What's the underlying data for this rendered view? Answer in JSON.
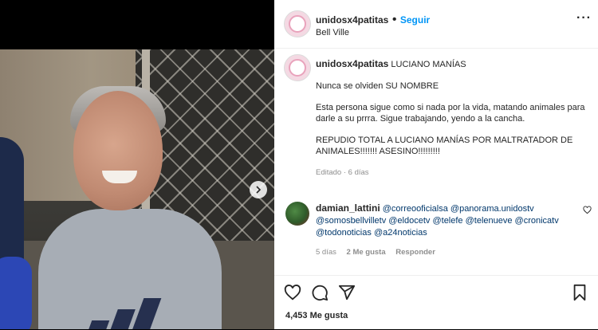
{
  "post": {
    "username": "unidosx4patitas",
    "separator": "•",
    "follow_label": "Seguir",
    "location": "Bell Ville",
    "more_label": "···"
  },
  "caption": {
    "username": "unidosx4patitas",
    "line1": "LUCIANO MANÍAS",
    "line2": "Nunca se olviden SU NOMBRE",
    "line3": "Esta persona sigue como si nada por la vida, matando animales para darle a su prrra. Sigue trabajando, yendo a la cancha.",
    "line4": "REPUDIO TOTAL A LUCIANO MANÍAS POR MALTRATADOR DE ANIMALES!!!!!!! ASESINO!!!!!!!!!",
    "meta": "Editado · 6 días"
  },
  "comment": {
    "username": "damian_lattini",
    "mentions": [
      "@correooficialsa",
      "@panorama.unidostv",
      "@somosbellvilletv",
      "@eldocetv",
      "@telefe",
      "@telenueve",
      "@cronicatv",
      "@todonoticias",
      "@a24noticias"
    ],
    "time": "5 días",
    "likes": "2 Me gusta",
    "reply_label": "Responder"
  },
  "actions": {
    "likes_count": "4,453 Me gusta"
  },
  "icons": [
    "heart-icon",
    "comment-icon",
    "share-icon",
    "bookmark-icon",
    "more-icon",
    "chevron-right-icon"
  ],
  "colors": {
    "accent": "#0095f6",
    "mention": "#00376b",
    "muted": "#8e8e8e"
  }
}
